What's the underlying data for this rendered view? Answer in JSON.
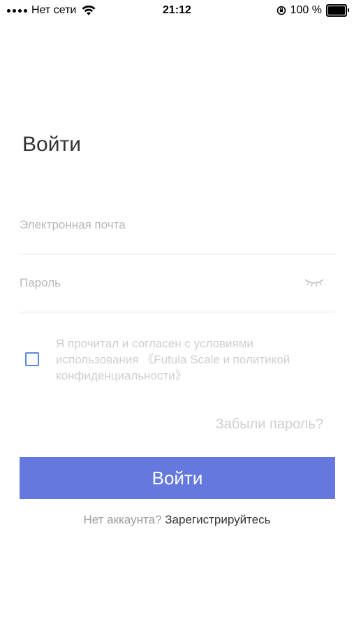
{
  "status_bar": {
    "carrier": "Нет сети",
    "time": "21:12",
    "battery": "100 %",
    "battery_level": 1.0
  },
  "title": "Войти",
  "email": {
    "placeholder": "Электронная почта",
    "value": ""
  },
  "password": {
    "placeholder": "Пароль",
    "value": ""
  },
  "agreement": {
    "checked": false,
    "text": "Я прочитал и согласен с условиями использования 《Futula Scale и политикой конфиденциальности》"
  },
  "forgot_password": "Забыли пароль?",
  "login_button": "Войти",
  "register": {
    "prompt": "Нет аккаунта?",
    "link": "Зарегистрируйтесь"
  },
  "colors": {
    "accent": "#6478dd",
    "checkbox_border": "#5b8bd8",
    "muted_text": "#cfcfcf"
  }
}
